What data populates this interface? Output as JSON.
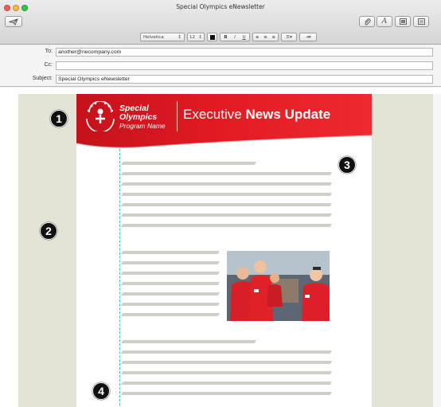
{
  "window": {
    "title": "Special Olympics eNewsletter"
  },
  "toolbar": {
    "send_icon": "send-icon",
    "attach_icon": "paperclip-icon",
    "fonts_label": "A",
    "photo_icon": "photo-browser-icon",
    "template_icon": "stationery-icon"
  },
  "format_bar": {
    "font_family": "Helvetica",
    "font_size": "12",
    "bold": "B",
    "italic": "I",
    "underline": "U"
  },
  "fields": {
    "to_label": "To:",
    "to_value": "another@necompany.com",
    "cc_label": "Cc:",
    "cc_value": "",
    "subject_label": "Subject:",
    "subject_value": "Special Olympics eNewsletter"
  },
  "newsletter": {
    "logo_line1": "Special",
    "logo_line2": "Olympics",
    "logo_line3": "Program Name",
    "title_regular": "Executive ",
    "title_bold": "News Update",
    "brand_red": "#e31b23"
  },
  "callouts": {
    "c1": "1",
    "c2": "2",
    "c3": "3",
    "c4": "4"
  }
}
